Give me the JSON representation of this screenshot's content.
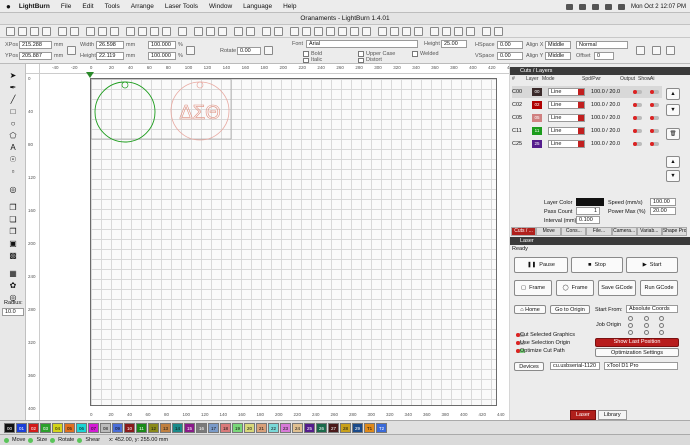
{
  "menubar": {
    "items": [
      "LightBurn",
      "File",
      "Edit",
      "Tools",
      "Arrange",
      "Laser Tools",
      "Window",
      "Language",
      "Help"
    ],
    "clock": "Mon Oct 2  12:07 PM"
  },
  "window_title": "Oranaments - LightBurn 1.4.01",
  "toolbar2": {
    "xpos_label": "XPos",
    "xpos": "215.288",
    "ypos_label": "YPos",
    "ypos": "205.887",
    "unit": "mm",
    "width_label": "Width",
    "width": "26.598",
    "height_label": "Height",
    "height": "22.119",
    "scale_w": "100.000",
    "scale_h": "100.000",
    "pct": "%",
    "rotate_label": "Rotate",
    "rotate": "0.00",
    "font_label": "Font",
    "font": "Arial",
    "height2_label": "Height",
    "height2": "25.00",
    "bold": "Bold",
    "italic": "Italic",
    "upper": "Upper Case",
    "distort": "Distort",
    "welded": "Welded",
    "hspace_label": "HSpace",
    "hspace": "0.00",
    "vspace_label": "VSpace",
    "vspace": "0.00",
    "alignx_label": "Align X",
    "alignx": "Middle",
    "aligny_label": "Align Y",
    "aligny": "Middle",
    "normal": "Normal",
    "offset_label": "Offset",
    "offset": "0"
  },
  "ruler": {
    "top": [
      "-40",
      "-20",
      "0",
      "20",
      "40",
      "60",
      "80",
      "100",
      "120",
      "140",
      "160",
      "180",
      "200",
      "220",
      "240",
      "260",
      "280",
      "300",
      "320",
      "340",
      "360",
      "380",
      "400",
      "420",
      "440"
    ],
    "left": [
      "0",
      "40",
      "80",
      "120",
      "160",
      "200",
      "240",
      "280",
      "320",
      "360",
      "400"
    ],
    "bottom_x": [
      "0",
      "20",
      "40",
      "60",
      "80",
      "100",
      "120",
      "140",
      "160",
      "180",
      "200",
      "220",
      "240",
      "260",
      "280",
      "300",
      "320",
      "340",
      "360",
      "380",
      "400",
      "420",
      "440"
    ]
  },
  "design": {
    "text": "ΔΣΘ"
  },
  "cuts": {
    "header": "Cuts / Layers",
    "columns": [
      "#",
      "Layer",
      "Mode",
      "Spd/Pwr",
      "Output",
      "Show",
      "Ai"
    ],
    "rows": [
      {
        "name": "C00",
        "num": "00",
        "mode": "Line",
        "spdpwr": "100.0 / 20.0",
        "color": "#3a2a2a"
      },
      {
        "name": "C02",
        "num": "02",
        "mode": "Line",
        "spdpwr": "100.0 / 20.0",
        "color": "#b00000"
      },
      {
        "name": "C05",
        "num": "05",
        "mode": "Line",
        "spdpwr": "100.0 / 20.0",
        "color": "#d08080"
      },
      {
        "name": "C11",
        "num": "11",
        "mode": "Line",
        "spdpwr": "100.0 / 20.0",
        "color": "#1c9c1c"
      },
      {
        "name": "C25",
        "num": "25",
        "mode": "Line",
        "spdpwr": "100.0 / 20.0",
        "color": "#541c8c"
      }
    ],
    "layer_color": "Layer Color",
    "speed_label": "Speed (mm/s)",
    "speed": "100.00",
    "pass_label": "Pass Count",
    "pass": "1",
    "power_label": "Power Max (%)",
    "power": "20.00",
    "interval_label": "Interval (mm)",
    "interval": "0.100"
  },
  "tabs1": [
    "Cuts / ...",
    "Move",
    "Cons...",
    "File...",
    "Camera...",
    "Variab...",
    "Shape Pro..."
  ],
  "laser": {
    "header": "Laser",
    "status": "Ready",
    "pause": "Pause",
    "stop": "Stop",
    "start": "Start",
    "frame1": "Frame",
    "frame2": "Frame",
    "save_gcode": "Save GCode",
    "run_gcode": "Run GCode",
    "home": "Home",
    "go_origin": "Go to Origin",
    "start_from_label": "Start From:",
    "start_from": "Absolute Coords",
    "job_origin": "Job Origin",
    "cut_selected": "Cut Selected Graphics",
    "use_selection": "Use Selection Origin",
    "optimize": "Optimize Cut Path",
    "show_last": "Show Last Position",
    "opt_settings": "Optimization Settings",
    "devices": "Devices",
    "port": "cu.usbserial-1120",
    "machine": "xTool D1 Pro"
  },
  "tabs2": [
    "Laser",
    "Library"
  ],
  "tools": {
    "radius_label": "Radius:",
    "radius": "10.0"
  },
  "palette": [
    {
      "t": "00",
      "c": "#111111"
    },
    {
      "t": "01",
      "c": "#1a3fd8"
    },
    {
      "t": "02",
      "c": "#d21a1a"
    },
    {
      "t": "03",
      "c": "#2ca02c"
    },
    {
      "t": "04",
      "c": "#d4d41a"
    },
    {
      "t": "05",
      "c": "#e07020"
    },
    {
      "t": "06",
      "c": "#1ad4d4"
    },
    {
      "t": "07",
      "c": "#d41ad4"
    },
    {
      "t": "08",
      "c": "#bbbbbb"
    },
    {
      "t": "09",
      "c": "#4a6ed8"
    },
    {
      "t": "10",
      "c": "#8a1a1a"
    },
    {
      "t": "11",
      "c": "#1a8a1a"
    },
    {
      "t": "12",
      "c": "#8a8a1a"
    },
    {
      "t": "13",
      "c": "#c08040"
    },
    {
      "t": "14",
      "c": "#1a8a8a"
    },
    {
      "t": "15",
      "c": "#8a1a8a"
    },
    {
      "t": "16",
      "c": "#7a7a7a"
    },
    {
      "t": "17",
      "c": "#7a9ac8"
    },
    {
      "t": "18",
      "c": "#d87a7a"
    },
    {
      "t": "19",
      "c": "#7ad87a"
    },
    {
      "t": "20",
      "c": "#d8d87a"
    },
    {
      "t": "21",
      "c": "#d8a07a"
    },
    {
      "t": "22",
      "c": "#7ad8d8"
    },
    {
      "t": "23",
      "c": "#d87ad8"
    },
    {
      "t": "24",
      "c": "#e0c090"
    },
    {
      "t": "25",
      "c": "#541c8c"
    },
    {
      "t": "26",
      "c": "#1a6a4a"
    },
    {
      "t": "27",
      "c": "#4a1a1a"
    },
    {
      "t": "28",
      "c": "#c8a01a"
    },
    {
      "t": "29",
      "c": "#1a4a8a"
    },
    {
      "t": "T1",
      "c": "#e08a1a"
    },
    {
      "t": "T2",
      "c": "#3a6ad8"
    }
  ],
  "status": {
    "move": "Move",
    "size": "Size",
    "rotate": "Rotate",
    "shear": "Shear",
    "coords": "x: 452.00, y: 255.00 mm"
  }
}
